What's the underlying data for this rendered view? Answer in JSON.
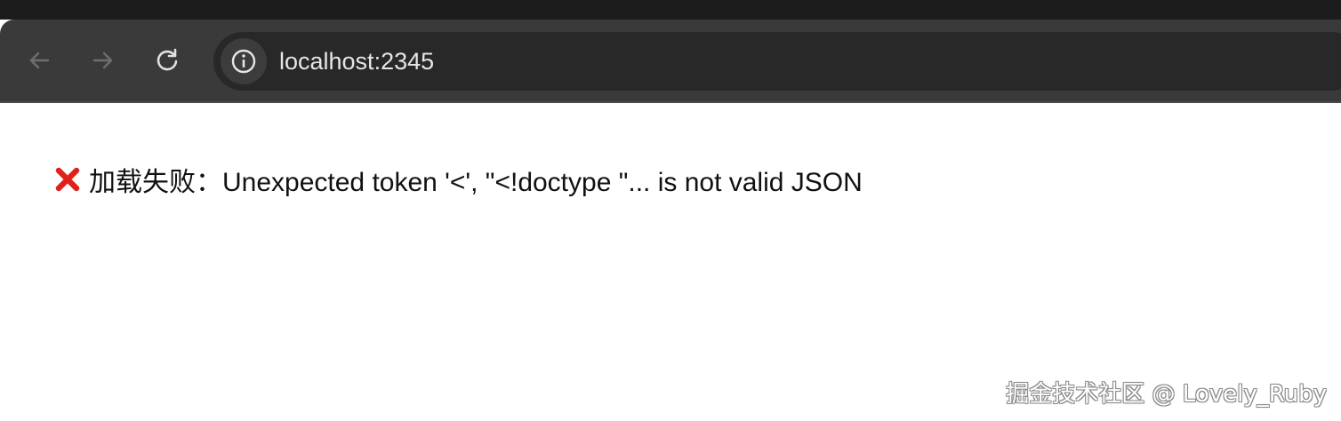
{
  "browser": {
    "nav": {
      "back_icon": "arrow-left-icon",
      "forward_icon": "arrow-right-icon",
      "reload_icon": "reload-icon"
    },
    "omnibox": {
      "site_info_icon": "info-circle-icon",
      "url": "localhost:2345"
    },
    "colors": {
      "frame": "#1c1c1d",
      "toolbar": "#3a3a3b",
      "omnibox": "#282828"
    }
  },
  "page": {
    "error": {
      "icon": "cross-mark-icon",
      "icon_color": "#e0201b",
      "message": "加载失败：Unexpected token '<', \"<!doctype \"... is not valid JSON"
    },
    "watermark": "掘金技术社区 @ Lovely_Ruby"
  }
}
